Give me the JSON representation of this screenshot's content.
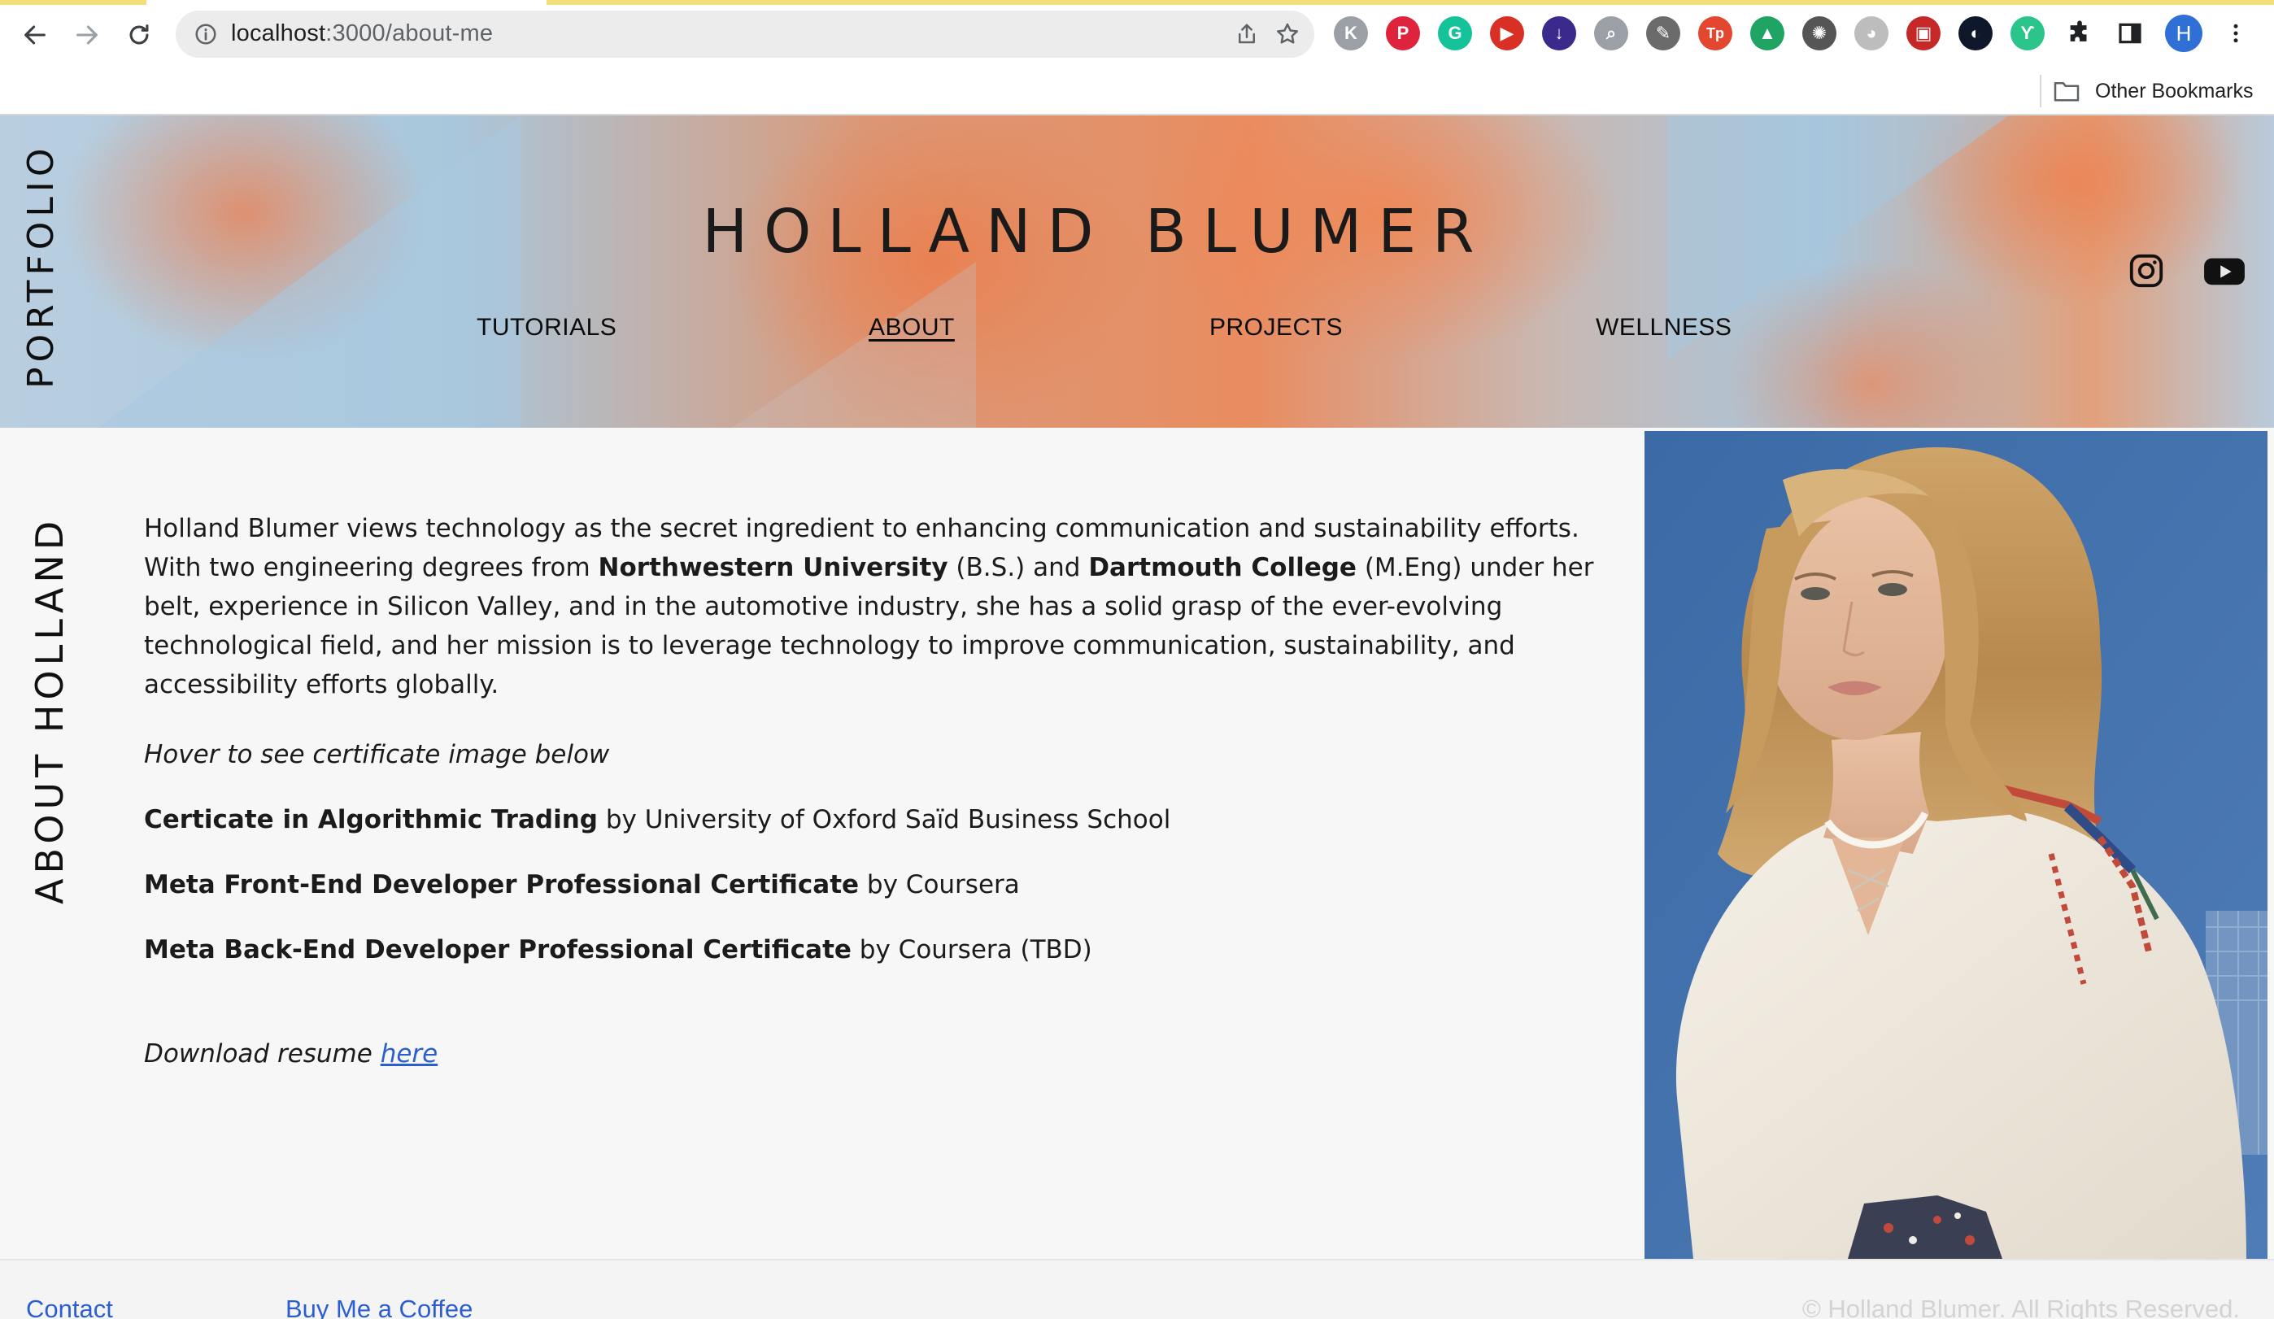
{
  "browser": {
    "url_host": "localhost",
    "url_path": ":3000/about-me",
    "profile_initial": "H",
    "other_bookmarks": "Other Bookmarks",
    "extensions": [
      {
        "name": "kee-extension-icon",
        "glyph": "K",
        "color": "#9aa0a6"
      },
      {
        "name": "pinterest-icon",
        "glyph": "P",
        "color": "#e0233c"
      },
      {
        "name": "grammarly-icon",
        "glyph": "G",
        "color": "#15c39a"
      },
      {
        "name": "youtube-ext-icon",
        "glyph": "▶",
        "color": "#d93025"
      },
      {
        "name": "download-icon",
        "glyph": "↓",
        "color": "#3b2a8c"
      },
      {
        "name": "search-ext-icon",
        "glyph": "⌕",
        "color": "#9aa0a6"
      },
      {
        "name": "bird-ext-icon",
        "glyph": "✎",
        "color": "#6b6b6b"
      },
      {
        "name": "tp-ext-icon",
        "glyph": "Tp",
        "color": "#e4472f"
      },
      {
        "name": "google-drive-icon",
        "glyph": "▲",
        "color": "#1fa463"
      },
      {
        "name": "openai-icon",
        "glyph": "✺",
        "color": "#555555"
      },
      {
        "name": "panda-ext-icon",
        "glyph": "◕",
        "color": "#bdbdbd"
      },
      {
        "name": "red-ext-icon",
        "glyph": "▣",
        "color": "#c62828"
      },
      {
        "name": "dark-circle-icon",
        "glyph": "◐",
        "color": "#0f172a"
      },
      {
        "name": "leaf-ext-icon",
        "glyph": "ϒ",
        "color": "#2bc48a"
      }
    ]
  },
  "header": {
    "side_label": "PORTFOLIO",
    "title": "HOLLAND BLUMER",
    "nav": [
      {
        "label": "TUTORIALS",
        "active": false
      },
      {
        "label": "ABOUT",
        "active": true
      },
      {
        "label": "PROJECTS",
        "active": false
      },
      {
        "label": "WELLNESS",
        "active": false
      }
    ],
    "social": [
      "instagram-icon",
      "youtube-icon"
    ]
  },
  "about": {
    "side_label": "ABOUT HOLLAND",
    "bio": {
      "p1": "Holland Blumer views technology as the secret ingredient to enhancing communication and sustainability efforts. With two engineering degrees from ",
      "school1": "Northwestern University",
      "p2": " (B.S.) and ",
      "school2": "Dartmouth College",
      "p3": " (M.Eng) under her belt, experience in Silicon Valley, and in the automotive industry, she has a solid grasp of the ever-evolving technological field, and her mission is to leverage technology to improve communication, sustainability, and accessibility efforts globally."
    },
    "hover_hint": "Hover to see certificate image below",
    "certificates": [
      {
        "title": "Certicate in Algorithmic Trading",
        "issuer": " by University of Oxford Saïd Business School"
      },
      {
        "title": "Meta Front-End Developer Professional Certificate",
        "issuer": " by Coursera"
      },
      {
        "title": "Meta Back-End Developer Professional Certificate",
        "issuer": " by Coursera (TBD)"
      }
    ],
    "resume_prefix": "Download resume ",
    "resume_link": "here"
  },
  "footer": {
    "links": [
      "Contact",
      "Buy Me a Coffee"
    ],
    "copyright": "© Holland Blumer. All Rights Reserved."
  },
  "colors": {
    "link": "#2b5fd1",
    "header_orange": "#e98c60",
    "header_blue": "#a9c7dc"
  }
}
